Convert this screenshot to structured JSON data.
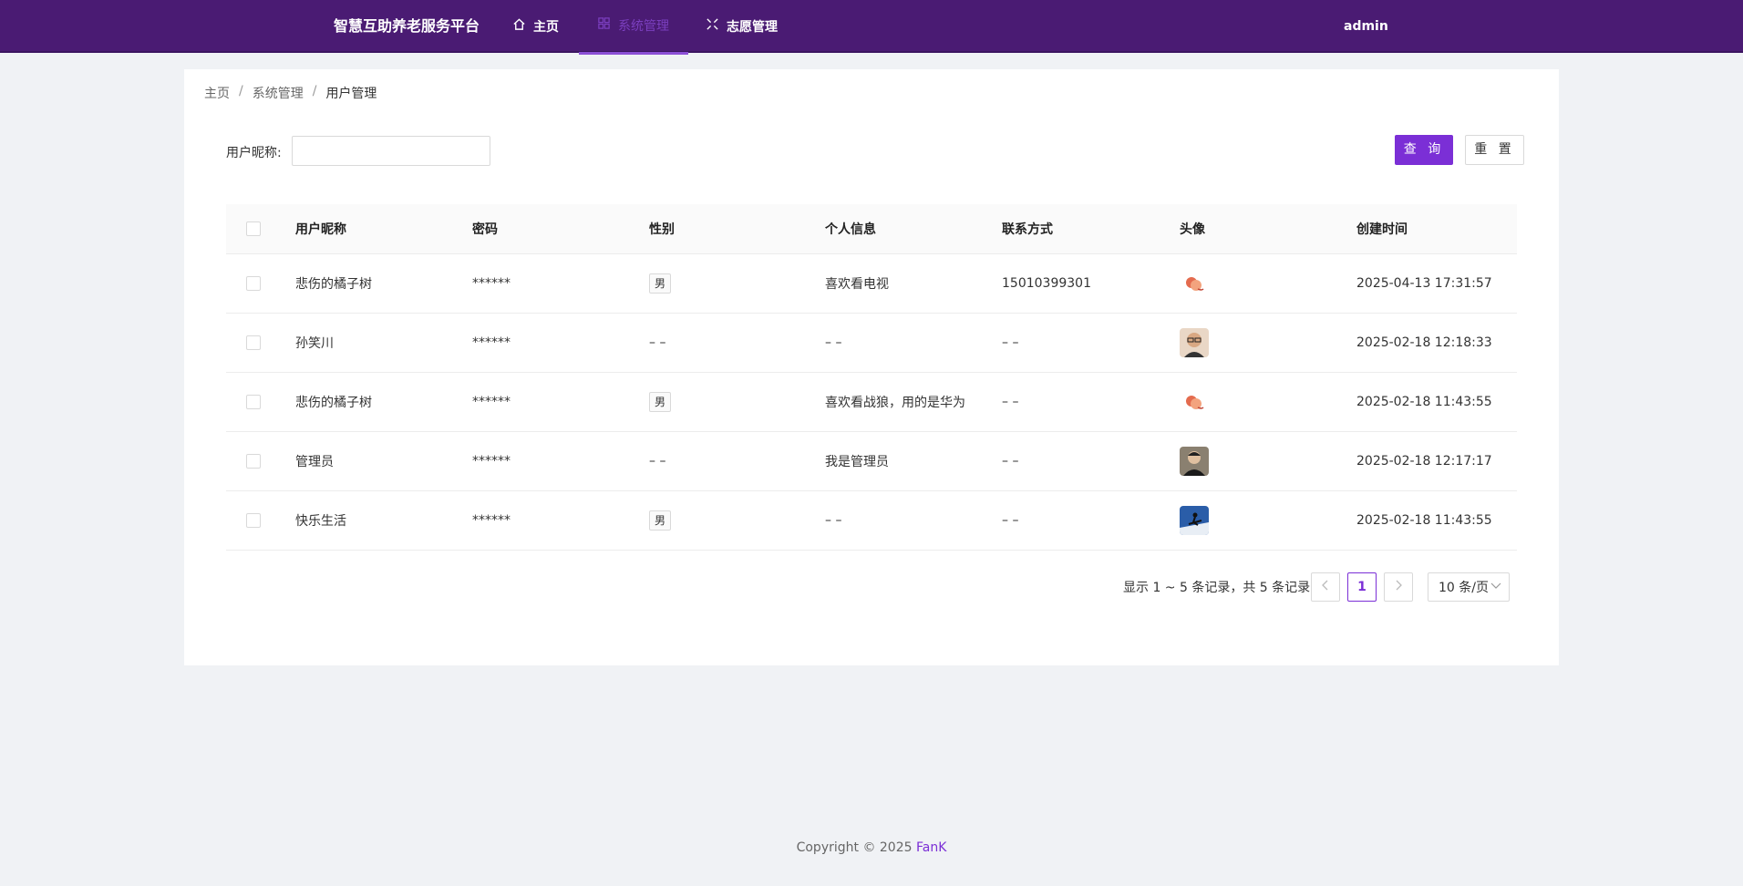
{
  "header": {
    "brand": "智慧互助养老服务平台",
    "nav": [
      {
        "label": "主页",
        "icon": "home-icon"
      },
      {
        "label": "系统管理",
        "icon": "grid-icon",
        "active": true
      },
      {
        "label": "志愿管理",
        "icon": "expand-icon"
      }
    ],
    "user": "admin",
    "colors": {
      "bar": "#4a1b73",
      "accent": "#7b2fd6"
    }
  },
  "breadcrumb": [
    "主页",
    "系统管理",
    "用户管理"
  ],
  "search": {
    "label": "用户昵称:",
    "value": "",
    "placeholder": ""
  },
  "buttons": {
    "query": "查 询",
    "reset": "重 置"
  },
  "table": {
    "columns": [
      "用户昵称",
      "密码",
      "性别",
      "个人信息",
      "联系方式",
      "头像",
      "创建时间"
    ],
    "rows": [
      {
        "name": "悲伤的橘子树",
        "password": "******",
        "gender": "男",
        "info": "喜欢看电视",
        "phone": "15010399301",
        "avatar": "peach-avatar",
        "created": "2025-04-13 17:31:57"
      },
      {
        "name": "孙笑川",
        "password": "******",
        "gender": "– –",
        "info": "– –",
        "phone": "– –",
        "avatar": "man-glasses-avatar",
        "created": "2025-02-18 12:18:33"
      },
      {
        "name": "悲伤的橘子树",
        "password": "******",
        "gender": "男",
        "info": "喜欢看战狼，用的是华为",
        "phone": "– –",
        "avatar": "peach-avatar",
        "created": "2025-02-18 11:43:55"
      },
      {
        "name": "管理员",
        "password": "******",
        "gender": "– –",
        "info": "我是管理员",
        "phone": "– –",
        "avatar": "man-portrait-avatar",
        "created": "2025-02-18 12:17:17"
      },
      {
        "name": "快乐生活",
        "password": "******",
        "gender": "男",
        "info": "– –",
        "phone": "– –",
        "avatar": "ski-avatar",
        "created": "2025-02-18 11:43:55"
      }
    ]
  },
  "pagination": {
    "info": "显示 1 ~ 5 条记录，共 5 条记录",
    "current": "1",
    "page_size": "10 条/页"
  },
  "footer": {
    "copyright": "Copyright © 2025 ",
    "author": "FanK"
  }
}
